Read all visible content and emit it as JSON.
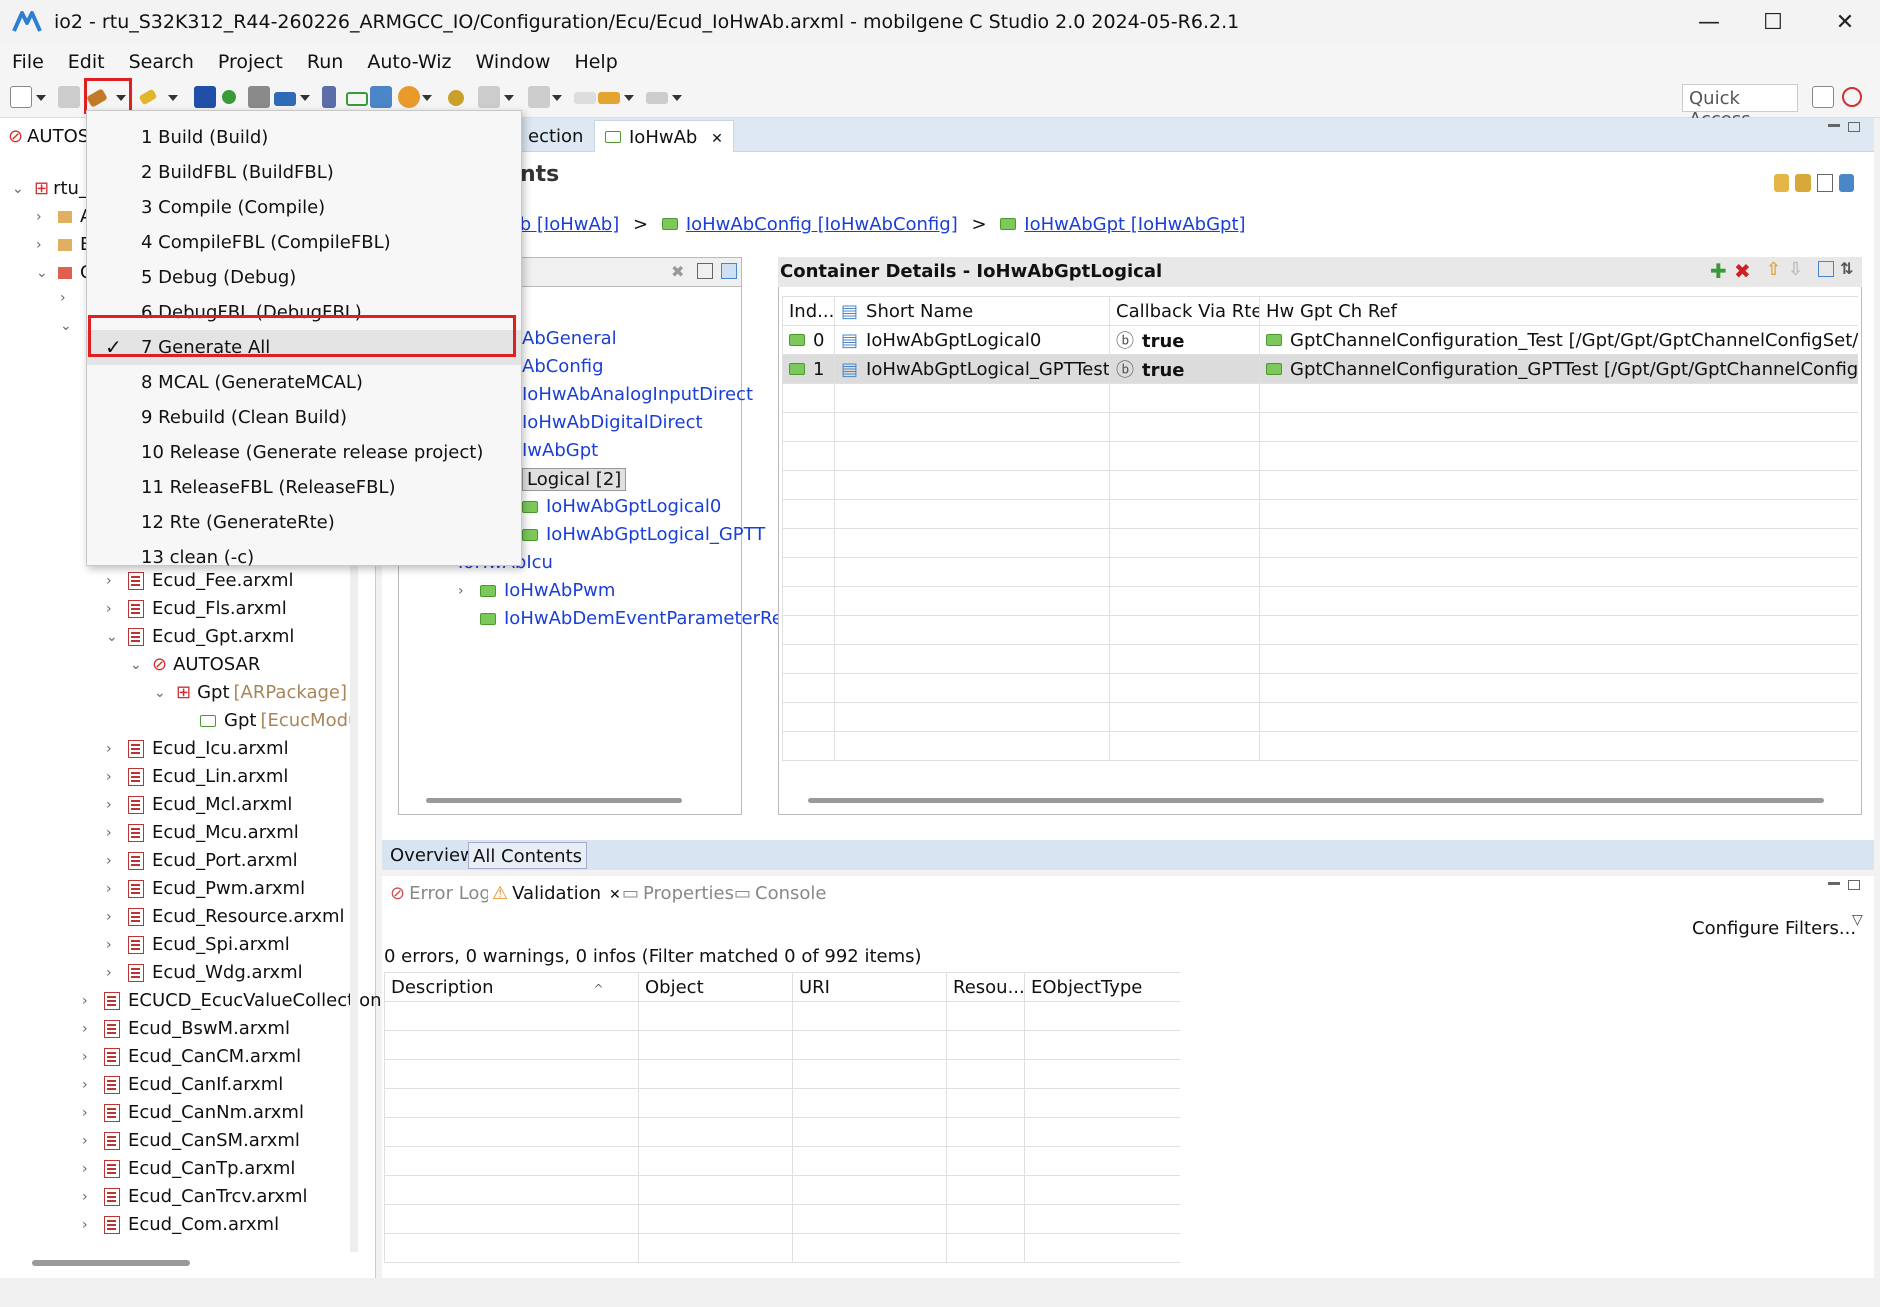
{
  "window": {
    "title": "io2 - rtu_S32K312_R44-260226_ARMGCC_IO/Configuration/Ecu/Ecud_IoHwAb.arxml - mobilgene C Studio 2.0 2024-05-R6.2.1",
    "minimize": "—",
    "maximize": "☐",
    "close": "✕"
  },
  "menu": {
    "items": [
      "File",
      "Edit",
      "Search",
      "Project",
      "Run",
      "Auto-Wiz",
      "Window",
      "Help"
    ]
  },
  "toolbar": {
    "quick_access": "Quick Access"
  },
  "build_menu": {
    "items": [
      {
        "label": "1 Build (Build)",
        "checked": false
      },
      {
        "label": "2 BuildFBL (BuildFBL)",
        "checked": false
      },
      {
        "label": "3 Compile (Compile)",
        "checked": false
      },
      {
        "label": "4 CompileFBL (CompileFBL)",
        "checked": false
      },
      {
        "label": "5 Debug (Debug)",
        "checked": false
      },
      {
        "label": "6 DebugFBL (DebugFBL)",
        "checked": false
      },
      {
        "label": "7 Generate All",
        "checked": true
      },
      {
        "label": "8 MCAL (GenerateMCAL)",
        "checked": false
      },
      {
        "label": "9 Rebuild (Clean  Build)",
        "checked": false
      },
      {
        "label": "10 Release (Generate release project)",
        "checked": false
      },
      {
        "label": "11 ReleaseFBL (ReleaseFBL)",
        "checked": false
      },
      {
        "label": "12 Rte (GenerateRte)",
        "checked": false
      },
      {
        "label": "13 clean (-c)",
        "checked": false
      }
    ],
    "check_mark": "✓"
  },
  "left_panel": {
    "tab_label": "AUTOS",
    "root_label": "rtu_",
    "partial_items": [
      "A",
      "B",
      "C"
    ],
    "files": [
      {
        "label": "Ecud_Fee.arxml",
        "indent": 2
      },
      {
        "label": "Ecud_Fls.arxml",
        "indent": 2
      },
      {
        "label": "Ecud_Gpt.arxml",
        "indent": 2,
        "expanded": true
      },
      {
        "label": "AUTOSAR",
        "indent": 3,
        "expanded": true,
        "kind": "autosar"
      },
      {
        "label": "Gpt",
        "suffix": "[ARPackage]",
        "indent": 4,
        "expanded": true,
        "kind": "package"
      },
      {
        "label": "Gpt",
        "suffix": "[EcucModu",
        "indent": 5,
        "kind": "module"
      },
      {
        "label": "Ecud_Icu.arxml",
        "indent": 2
      },
      {
        "label": "Ecud_Lin.arxml",
        "indent": 2
      },
      {
        "label": "Ecud_Mcl.arxml",
        "indent": 2
      },
      {
        "label": "Ecud_Mcu.arxml",
        "indent": 2
      },
      {
        "label": "Ecud_Port.arxml",
        "indent": 2
      },
      {
        "label": "Ecud_Pwm.arxml",
        "indent": 2
      },
      {
        "label": "Ecud_Resource.arxml",
        "indent": 2
      },
      {
        "label": "Ecud_Spi.arxml",
        "indent": 2
      },
      {
        "label": "Ecud_Wdg.arxml",
        "indent": 2
      },
      {
        "label": "ECUCD_EcucValueCollection",
        "indent": 1
      },
      {
        "label": "Ecud_BswM.arxml",
        "indent": 1
      },
      {
        "label": "Ecud_CanCM.arxml",
        "indent": 1
      },
      {
        "label": "Ecud_CanIf.arxml",
        "indent": 1
      },
      {
        "label": "Ecud_CanNm.arxml",
        "indent": 1
      },
      {
        "label": "Ecud_CanSM.arxml",
        "indent": 1
      },
      {
        "label": "Ecud_CanTp.arxml",
        "indent": 1
      },
      {
        "label": "Ecud_CanTrcv.arxml",
        "indent": 1
      },
      {
        "label": "Ecud_Com.arxml",
        "indent": 1
      }
    ]
  },
  "editor": {
    "tabs": [
      "ection",
      "IoHwAb"
    ],
    "heading": "nts",
    "breadcrumb": [
      "b [IoHwAb]",
      "IoHwAbConfig [IoHwAbConfig]",
      "IoHwAbGpt [IoHwAbGpt]"
    ],
    "breadcrumb_sep": ">",
    "inner_tree": [
      {
        "label": "AbGeneral",
        "indent": 0
      },
      {
        "label": "AbConfig",
        "indent": 0
      },
      {
        "label": "IoHwAbAnalogInputDirect",
        "indent": 0
      },
      {
        "label": "IoHwAbDigitalDirect",
        "indent": 0
      },
      {
        "label": "IwAbGpt",
        "indent": 0
      },
      {
        "label": "Logical [2]",
        "indent": 0,
        "selected": true
      },
      {
        "label": "IoHwAbGptLogical0",
        "indent": 1
      },
      {
        "label": "IoHwAbGptLogical_GPTT",
        "indent": 1
      },
      {
        "label": "IoHwAbIcu",
        "indent": -1
      },
      {
        "label": "IoHwAbPwm",
        "indent": -1
      },
      {
        "label": "IoHwAbDemEventParameterRe",
        "indent": -1
      }
    ],
    "details_title": "Container Details - IoHwAbGptLogical",
    "columns": [
      "Ind...",
      "Short Name",
      "Callback Via Rte",
      "Hw Gpt Ch Ref"
    ],
    "rows": [
      {
        "index": "0",
        "name": "IoHwAbGptLogical0",
        "callback": "true",
        "ref": "GptChannelConfiguration_Test [/Gpt/Gpt/GptChannelConfigSet/GptC..."
      },
      {
        "index": "1",
        "name": "IoHwAbGptLogical_GPTTest",
        "callback": "true",
        "ref": "GptChannelConfiguration_GPTTest [/Gpt/Gpt/GptChannelConfigSet/..."
      }
    ],
    "bottom_tabs": [
      "Overview",
      "All Contents"
    ]
  },
  "bottom_panel": {
    "tabs": [
      "Error Log",
      "Validation",
      "Properties",
      "Console"
    ],
    "configure_filters": "Configure Filters...",
    "summary": "0 errors, 0 warnings, 0 infos (Filter matched 0 of 992 items)",
    "columns": [
      "Description",
      "Object",
      "URI",
      "Resou...",
      "EObjectType"
    ]
  },
  "colors": {
    "accent_tab": "#dde8f3",
    "link": "#1a3fd6",
    "highlight_box": "#e02020"
  }
}
